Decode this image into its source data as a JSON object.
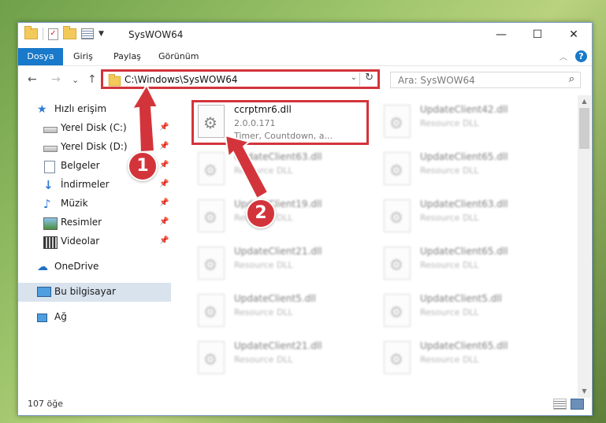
{
  "window": {
    "title": "SysWOW64",
    "minimize": "—",
    "maximize": "☐",
    "close": "✕"
  },
  "ribbon": {
    "tabs": [
      "Dosya",
      "Giriş",
      "Paylaş",
      "Görünüm"
    ],
    "help": "?"
  },
  "nav": {
    "back": "←",
    "forward": "→",
    "recent": "⌄",
    "up": "↑",
    "address": "C:\\Windows\\SysWOW64",
    "address_dropdown": "⌄",
    "refresh": "↻",
    "search_placeholder": "Ara: SysWOW64",
    "search_icon": "⌕"
  },
  "sidebar": {
    "items": [
      {
        "label": "Hızlı erişim",
        "icon": "star-icon",
        "pinned": false
      },
      {
        "label": "Yerel Disk (C:)",
        "icon": "drive-icon",
        "pinned": true
      },
      {
        "label": "Yerel Disk (D:)",
        "icon": "drive-icon",
        "pinned": true
      },
      {
        "label": "Belgeler",
        "icon": "documents-icon",
        "pinned": true
      },
      {
        "label": "İndirmeler",
        "icon": "download-icon",
        "pinned": true
      },
      {
        "label": "Müzik",
        "icon": "music-icon",
        "pinned": true
      },
      {
        "label": "Resimler",
        "icon": "pictures-icon",
        "pinned": true
      },
      {
        "label": "Videolar",
        "icon": "videos-icon",
        "pinned": true
      },
      {
        "label": "OneDrive",
        "icon": "cloud-icon",
        "pinned": false
      },
      {
        "label": "Bu bilgisayar",
        "icon": "computer-icon",
        "pinned": false,
        "selected": true
      },
      {
        "label": "Ağ",
        "icon": "network-icon",
        "pinned": false
      }
    ],
    "pin_glyph": "📌"
  },
  "files": [
    {
      "name": "ccrptmr6.dll",
      "line1": "2.0.0.171",
      "line2": "Timer, Countdown, a...",
      "highlighted": true
    },
    {
      "name": "UpdateClient42.dll",
      "line1": "Resource DLL"
    },
    {
      "name": "UpdateClient63.dll",
      "line1": "Resource DLL"
    },
    {
      "name": "UpdateClient65.dll",
      "line1": "Resource DLL"
    },
    {
      "name": "UpdateClient19.dll",
      "line1": "Resource DLL"
    },
    {
      "name": "UpdateClient63.dll",
      "line1": "Resource DLL"
    },
    {
      "name": "UpdateClient21.dll",
      "line1": "Resource DLL"
    },
    {
      "name": "UpdateClient65.dll",
      "line1": "Resource DLL"
    },
    {
      "name": "UpdateClient5.dll",
      "line1": "Resource DLL"
    },
    {
      "name": "UpdateClient5.dll",
      "line1": "Resource DLL"
    },
    {
      "name": "UpdateClient21.dll",
      "line1": "Resource DLL"
    },
    {
      "name": "UpdateClient65.dll",
      "line1": "Resource DLL"
    }
  ],
  "status": {
    "count": "107 öğe"
  },
  "annotations": {
    "step1": "1",
    "step2": "2",
    "color": "#d3343b"
  }
}
